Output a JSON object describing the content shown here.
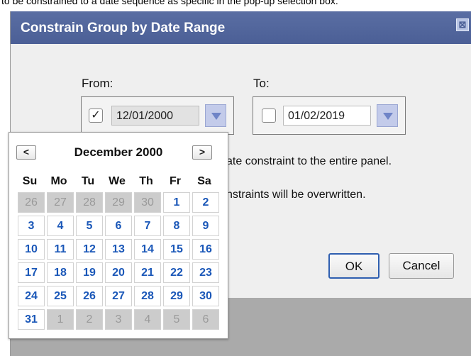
{
  "caption": "to be constrained to a date sequence as specific in the pop-up selection box.",
  "dialog": {
    "title": "Constrain Group by Date Range",
    "close_glyph": "⊠",
    "from": {
      "label": "From:",
      "checked": true,
      "check_glyph": "✓",
      "value": "12/01/2000"
    },
    "to": {
      "label": "To:",
      "checked": false,
      "check_glyph": "",
      "value": "01/02/2019"
    },
    "message1": "ate constraint to the entire panel.",
    "message2": "nstraints will be overwritten.",
    "ok_label": "OK",
    "cancel_label": "Cancel"
  },
  "calendar": {
    "prev_label": "<",
    "next_label": ">",
    "month_label": "December 2000",
    "days_of_week": [
      "Su",
      "Mo",
      "Tu",
      "We",
      "Th",
      "Fr",
      "Sa"
    ],
    "weeks": [
      [
        {
          "d": "26",
          "other": true
        },
        {
          "d": "27",
          "other": true
        },
        {
          "d": "28",
          "other": true
        },
        {
          "d": "29",
          "other": true
        },
        {
          "d": "30",
          "other": true
        },
        {
          "d": "1",
          "other": false
        },
        {
          "d": "2",
          "other": false
        }
      ],
      [
        {
          "d": "3",
          "other": false
        },
        {
          "d": "4",
          "other": false
        },
        {
          "d": "5",
          "other": false
        },
        {
          "d": "6",
          "other": false
        },
        {
          "d": "7",
          "other": false
        },
        {
          "d": "8",
          "other": false
        },
        {
          "d": "9",
          "other": false
        }
      ],
      [
        {
          "d": "10",
          "other": false
        },
        {
          "d": "11",
          "other": false
        },
        {
          "d": "12",
          "other": false
        },
        {
          "d": "13",
          "other": false
        },
        {
          "d": "14",
          "other": false
        },
        {
          "d": "15",
          "other": false
        },
        {
          "d": "16",
          "other": false
        }
      ],
      [
        {
          "d": "17",
          "other": false
        },
        {
          "d": "18",
          "other": false
        },
        {
          "d": "19",
          "other": false
        },
        {
          "d": "20",
          "other": false
        },
        {
          "d": "21",
          "other": false
        },
        {
          "d": "22",
          "other": false
        },
        {
          "d": "23",
          "other": false
        }
      ],
      [
        {
          "d": "24",
          "other": false
        },
        {
          "d": "25",
          "other": false
        },
        {
          "d": "26",
          "other": false
        },
        {
          "d": "27",
          "other": false
        },
        {
          "d": "28",
          "other": false
        },
        {
          "d": "29",
          "other": false
        },
        {
          "d": "30",
          "other": false
        }
      ],
      [
        {
          "d": "31",
          "other": false
        },
        {
          "d": "1",
          "other": true
        },
        {
          "d": "2",
          "other": true
        },
        {
          "d": "3",
          "other": true
        },
        {
          "d": "4",
          "other": true
        },
        {
          "d": "5",
          "other": true
        },
        {
          "d": "6",
          "other": true
        }
      ]
    ]
  }
}
